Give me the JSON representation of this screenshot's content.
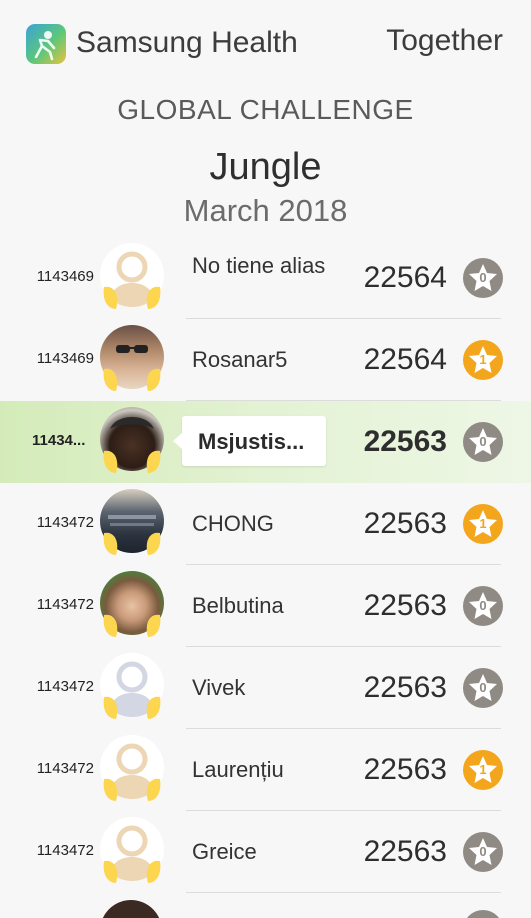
{
  "header": {
    "app_title": "Samsung Health",
    "together_label": "Together",
    "logo_icon": "samsung-health-logo"
  },
  "challenge": {
    "label": "GLOBAL CHALLENGE",
    "name": "Jungle",
    "date": "March 2018"
  },
  "colors": {
    "highlight_row": "#d4ebb9",
    "badge_gray": "#8f8a84",
    "badge_gold": "#f3a51b",
    "wing_yellow": "#fcd64e"
  },
  "leaderboard": [
    {
      "rank": "1143469",
      "name": "No tiene alias",
      "steps": "22564",
      "badge": "0",
      "badge_type": "gray",
      "avatar": "default-beige"
    },
    {
      "rank": "1143469",
      "name": "Rosanar5",
      "steps": "22564",
      "badge": "1",
      "badge_type": "gold",
      "avatar": "photo"
    },
    {
      "rank": "11434...",
      "name": "Msjustis...",
      "steps": "22563",
      "badge": "0",
      "badge_type": "gray",
      "avatar": "photo",
      "current_user": true
    },
    {
      "rank": "1143472",
      "name": "CHONG",
      "steps": "22563",
      "badge": "1",
      "badge_type": "gold",
      "avatar": "photo"
    },
    {
      "rank": "1143472",
      "name": "Belbutina",
      "steps": "22563",
      "badge": "0",
      "badge_type": "gray",
      "avatar": "photo"
    },
    {
      "rank": "1143472",
      "name": "Vivek",
      "steps": "22563",
      "badge": "0",
      "badge_type": "gray",
      "avatar": "default-gray"
    },
    {
      "rank": "1143472",
      "name": "Laurențiu",
      "steps": "22563",
      "badge": "1",
      "badge_type": "gold",
      "avatar": "default-beige"
    },
    {
      "rank": "1143472",
      "name": "Greice",
      "steps": "22563",
      "badge": "0",
      "badge_type": "gray",
      "avatar": "default-beige"
    }
  ]
}
